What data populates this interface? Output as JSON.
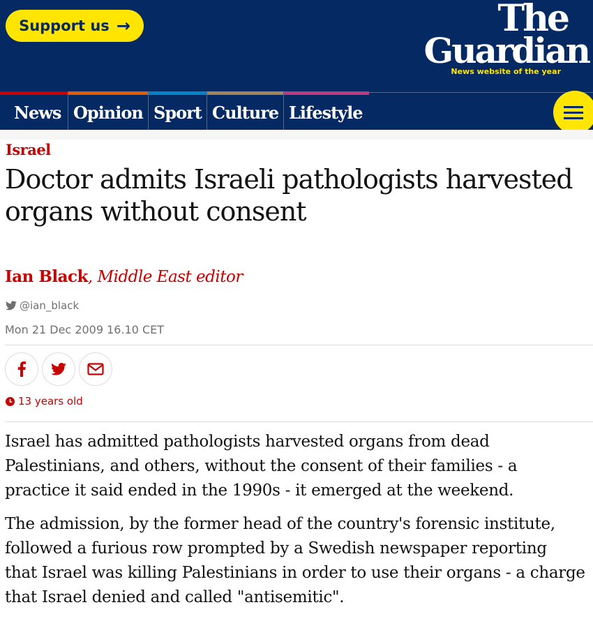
{
  "header": {
    "support_label": "Support us",
    "support_arrow": "→",
    "logo_line1": "The",
    "logo_line2": "Guardian",
    "logo_tagline": "News website of the year",
    "menu_icon": "hamburger-menu-icon",
    "colors": {
      "brand_blue": "#052962",
      "yellow": "#ffe500"
    }
  },
  "nav": {
    "items": [
      {
        "label": "News",
        "color": "#c70000"
      },
      {
        "label": "Opinion",
        "color": "#e05e00"
      },
      {
        "label": "Sport",
        "color": "#0084c6"
      },
      {
        "label": "Culture",
        "color": "#a1845c"
      },
      {
        "label": "Lifestyle",
        "color": "#bb3b80"
      }
    ]
  },
  "article": {
    "kicker": "Israel",
    "headline_lines": [
      "Doctor admits Israeli pathologists harvested",
      "organs without consent"
    ],
    "byline_name": "Ian Black",
    "byline_role": ", Middle East editor",
    "twitter_handle": "@ian_black",
    "dateline": "Mon 21 Dec 2009 16.10 CET",
    "share": [
      {
        "name": "facebook-share",
        "icon": "facebook-icon"
      },
      {
        "name": "twitter-share",
        "icon": "twitter-icon"
      },
      {
        "name": "email-share",
        "icon": "email-icon"
      }
    ],
    "age": "13 years old",
    "paragraphs": [
      [
        "Israel has admitted pathologists harvested organs from dead",
        "Palestinians, and others, without the consent of their families - a",
        "practice it said ended in the 1990s - it emerged at the weekend."
      ],
      [
        "The admission, by the former head of the country's forensic institute,",
        "followed a furious row prompted by a Swedish newspaper reporting",
        "that Israel was killing Palestinians in order to use their organs - a charge",
        "that Israel denied and called \"antisemitic\"."
      ]
    ],
    "accent_red": "#c70000"
  }
}
